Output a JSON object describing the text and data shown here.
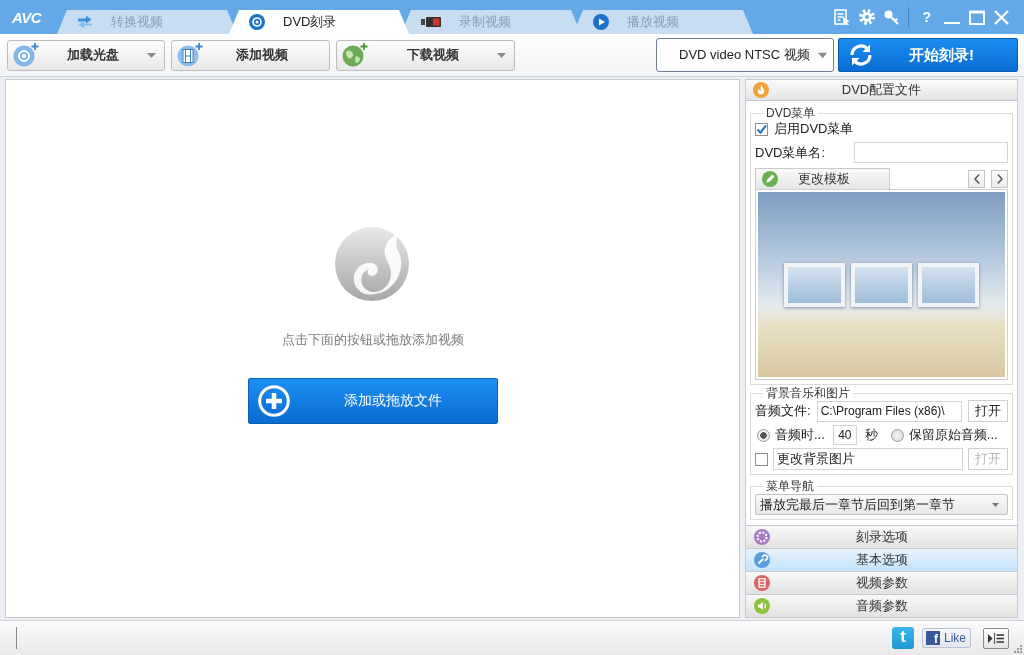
{
  "app": {
    "logo": "AVC"
  },
  "tabs": [
    {
      "label": "转换视频",
      "selected": false
    },
    {
      "label": "DVD刻录",
      "selected": true
    },
    {
      "label": "录制视频",
      "selected": false
    },
    {
      "label": "播放视频",
      "selected": false
    }
  ],
  "window_controls": {
    "help": "?"
  },
  "toolbar": {
    "buttons": [
      {
        "label": "加载光盘",
        "dropdown": true
      },
      {
        "label": "添加视频",
        "dropdown": false
      },
      {
        "label": "下载视频",
        "dropdown": true
      }
    ],
    "profile": "DVD video NTSC 视频",
    "start_button": "开始刻录!"
  },
  "drop_area": {
    "hint": "点击下面的按钮或拖放添加视频",
    "button": "添加或拖放文件"
  },
  "side_panel": {
    "title": "DVD配置文件",
    "dvd_menu": {
      "legend": "DVD菜单",
      "enable_menu": {
        "label": "启用DVD菜单",
        "checked": true
      },
      "name_label": "DVD菜单名:",
      "template_tab": "更改模板"
    },
    "background": {
      "legend": "背景音乐和图片",
      "audio_label": "音频文件:",
      "audio_path": "C:\\Program Files (x86)\\",
      "audio_open": "打开",
      "audio_modes": [
        {
          "label": "音频时...",
          "selected": true
        },
        {
          "label": "保留原始音频...",
          "selected": false
        }
      ],
      "duration": "40",
      "duration_unit": "秒",
      "change_image": {
        "checked": false,
        "value": "更改背景图片"
      },
      "image_open": {
        "label": "打开",
        "disabled": true
      }
    },
    "navigation": {
      "legend": "菜单导航",
      "value": "播放完最后一章节后回到第一章节"
    },
    "sections": [
      {
        "label": "刻录选项",
        "selected": false
      },
      {
        "label": "基本选项",
        "selected": true
      },
      {
        "label": "视频参数",
        "selected": false
      },
      {
        "label": "音频参数",
        "selected": false
      }
    ]
  },
  "status_bar": {
    "twitter": "t",
    "facebook": "f",
    "like": "Like"
  }
}
